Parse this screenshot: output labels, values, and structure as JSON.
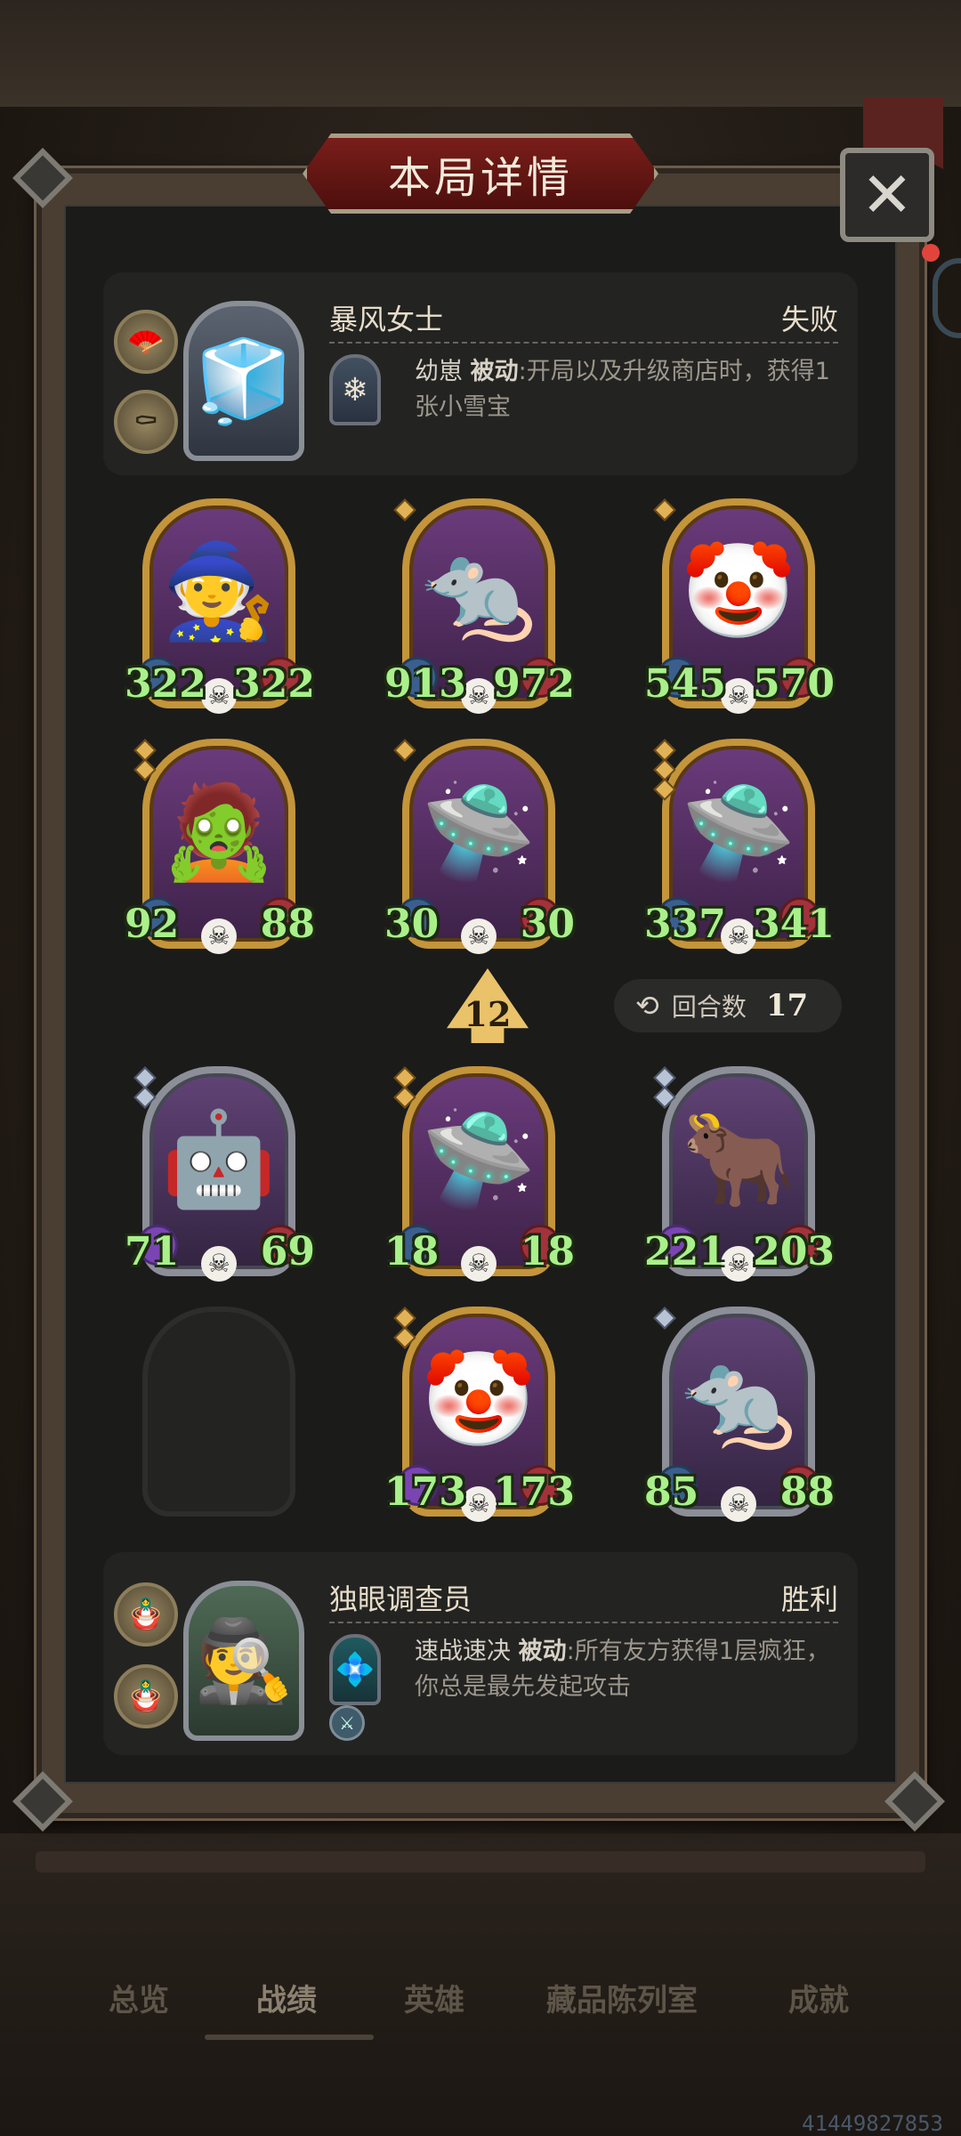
{
  "title": "本局详情",
  "close_label": "✕",
  "opponent": {
    "name": "暴风女士",
    "result": "失败",
    "relics": [
      "fan-icon",
      "coffin-icon"
    ],
    "skill_name": "幼崽",
    "skill_tag": "被动",
    "skill_text": ":开局以及升级商店时，获得1张小雪宝"
  },
  "player": {
    "name": "独眼调查员",
    "result": "胜利",
    "relics": [
      "voodoo-doll-icon",
      "purple-doll-icon"
    ],
    "skill_name": "速战速决",
    "skill_tag": "被动",
    "skill_text": ":所有友方获得1层疯狂，你总是最先发起攻击"
  },
  "opponent_units": [
    {
      "name": "wizard",
      "art": "🧙",
      "atk": "322",
      "hp": "322",
      "stars": 0,
      "tier": "gold"
    },
    {
      "name": "rat",
      "art": "🐀",
      "atk": "913",
      "hp": "972",
      "stars": 1,
      "tier": "gold"
    },
    {
      "name": "clown",
      "art": "🤡",
      "atk": "545",
      "hp": "570",
      "stars": 1,
      "tier": "gold"
    },
    {
      "name": "hooded-mage",
      "art": "🧟",
      "atk": "92",
      "hp": "88",
      "stars": 2,
      "tier": "gold"
    },
    {
      "name": "airship",
      "art": "🛸",
      "atk": "30",
      "hp": "30",
      "stars": 1,
      "tier": "gold"
    },
    {
      "name": "airship",
      "art": "🛸",
      "atk": "337",
      "hp": "341",
      "stars": 3,
      "tier": "gold"
    }
  ],
  "player_units": [
    {
      "name": "robot",
      "art": "🤖",
      "atk": "71",
      "hp": "69",
      "stars": 2,
      "tier": "silver"
    },
    {
      "name": "airship",
      "art": "🛸",
      "atk": "18",
      "hp": "18",
      "stars": 2,
      "tier": "gold"
    },
    {
      "name": "fire-bull",
      "art": "🐂",
      "atk": "221",
      "hp": "203",
      "stars": 2,
      "tier": "silver"
    },
    {
      "name": "empty",
      "art": "",
      "atk": "",
      "hp": "",
      "stars": 0,
      "tier": "empty"
    },
    {
      "name": "clown",
      "art": "🤡",
      "atk": "173",
      "hp": "173",
      "stars": 2,
      "tier": "gold"
    },
    {
      "name": "rat",
      "art": "🐀",
      "atk": "85",
      "hp": "88",
      "stars": 1,
      "tier": "silver"
    }
  ],
  "level": "12",
  "turns": {
    "label": "回合数",
    "value": "17"
  },
  "nav": [
    "总览",
    "战绩",
    "英雄",
    "藏品陈列室",
    "成就"
  ],
  "nav_active": "战绩",
  "id_text": "41449827853"
}
